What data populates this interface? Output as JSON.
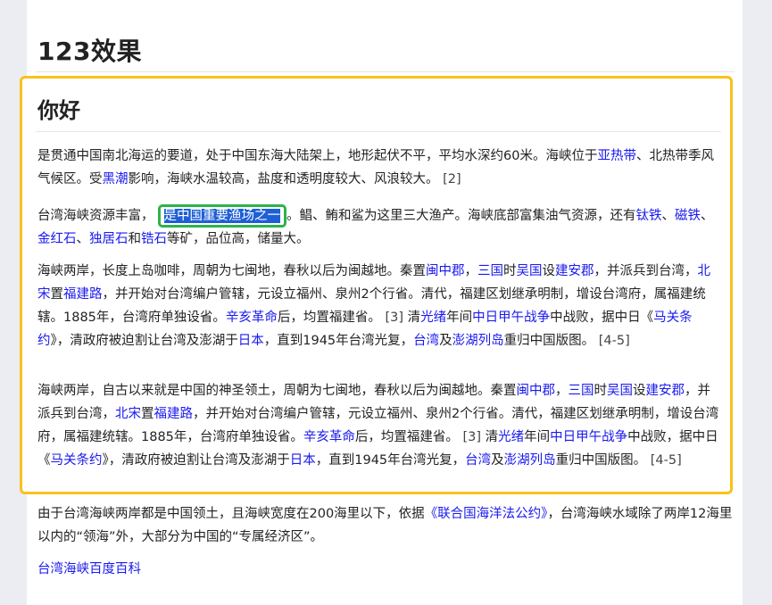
{
  "page": {
    "title": "123效果",
    "section": {
      "title": "你好",
      "p1": [
        "是贯通中国南北海运的要道，处于中国东海大陆架上，地形起伏不平，平均水深约60米。海峡位于",
        "亚热带",
        "、北热带季风气候区。受",
        "黑潮",
        "影响，海峡水温较高，盐度和透明度较大、风浪较大。",
        "[2]"
      ],
      "p2": [
        "台湾海峡资源丰富，",
        "是中国重要渔场之一",
        "。鲳、鲔和鲨为这里三大渔产。海峡底部富集油气资源，还有",
        "钛铁",
        "、",
        "磁铁",
        "、",
        "金红石",
        "、",
        "独居石",
        "和",
        "锆石",
        "等矿，品位高，储量大。"
      ],
      "p3": [
        "海峡两岸，长度上岛咖啡，周朝为七闽地，春秋以后为闽越地。秦置",
        "闽中郡",
        "，",
        "三国",
        "时",
        "吴国",
        "设",
        "建安郡",
        "，并派兵到台湾，",
        "北宋",
        "置",
        "福建路",
        "，并开始对台湾编户管辖，元设立福州、泉州2个行省。清代，福建区划继承明制，增设台湾府，属福建统辖。1885年，台湾府单独设省。",
        "辛亥革命",
        "后，均置福建省。",
        "[3]",
        "清",
        "光绪",
        "年间",
        "中日甲午战争",
        "中战败，据中日《",
        "马关条约",
        "》，清政府被迫割让台湾及澎湖于",
        "日本",
        "，直到1945年台湾光复，",
        "台湾",
        "及",
        "澎湖列岛",
        "重归中国版图。",
        "[4-5]"
      ],
      "p4": [
        "海峡两岸，自古以来就是中国的神圣领土，周朝为七闽地，春秋以后为闽越地。秦置",
        "闽中郡",
        "，",
        "三国",
        "时",
        "吴国",
        "设",
        "建安郡",
        "，并派兵到台湾，",
        "北宋",
        "置",
        "福建路",
        "，并开始对台湾编户管辖，元设立福州、泉州2个行省。清代，福建区划继承明制，增设台湾府，属福建统辖。1885年，台湾府单独设省。",
        "辛亥革命",
        "后，均置福建省。",
        "[3]",
        "清",
        "光绪",
        "年间",
        "中日甲午战争",
        "中战败，据中日《",
        "马关条约",
        "》，清政府被迫割让台湾及澎湖于",
        "日本",
        "，直到1945年台湾光复，",
        "台湾",
        "及",
        "澎湖列岛",
        "重归中国版图。",
        "[4-5]"
      ]
    },
    "p5": [
      "由于台湾海峡两岸都是中国领土，且海峡宽度在200海里以下，依据",
      "《联合国海洋法公约》",
      "，台湾海峡水域除了两岸12海里以内的“领海”外，大部分为中国的“专属经济区”。"
    ],
    "source_link": "台湾海峡百度百科"
  },
  "colors": {
    "highlight_border": "#f8c21c",
    "selection_box": "#2db34a",
    "selection_bg": "#1f5fd6",
    "link": "#1a1aee"
  }
}
